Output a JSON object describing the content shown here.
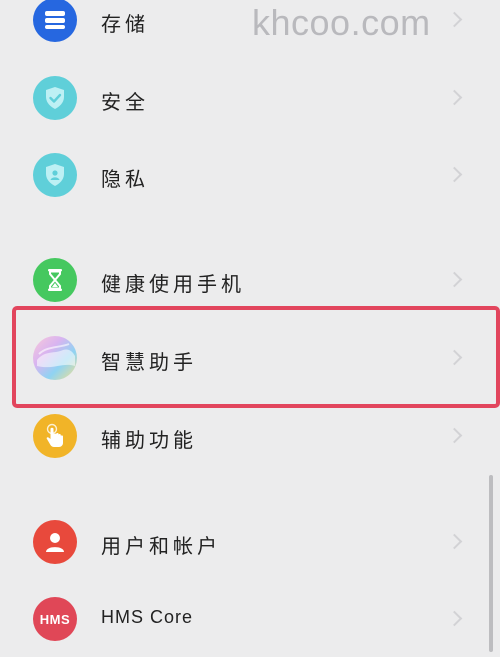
{
  "watermark": "khcoo.com",
  "settings": {
    "items": [
      {
        "label": "存储",
        "icon": "storage-icon",
        "color": "#2667e0"
      },
      {
        "label": "安全",
        "icon": "shield-check-icon",
        "color": "#5fcfd9"
      },
      {
        "label": "隐私",
        "icon": "privacy-shield-icon",
        "color": "#5fcfd9"
      },
      {
        "label": "健康使用手机",
        "icon": "hourglass-icon",
        "color": "#45c85f"
      },
      {
        "label": "智慧助手",
        "icon": "smart-assistant-icon",
        "color": "#c9a6e8"
      },
      {
        "label": "辅助功能",
        "icon": "hand-pointer-icon",
        "color": "#f1b428"
      },
      {
        "label": "用户和帐户",
        "icon": "user-icon",
        "color": "#e8493c"
      },
      {
        "label": "HMS Core",
        "icon": "hms-icon",
        "color": "#e04757",
        "icon_text": "HMS"
      }
    ]
  },
  "highlight_color": "#e2455d"
}
